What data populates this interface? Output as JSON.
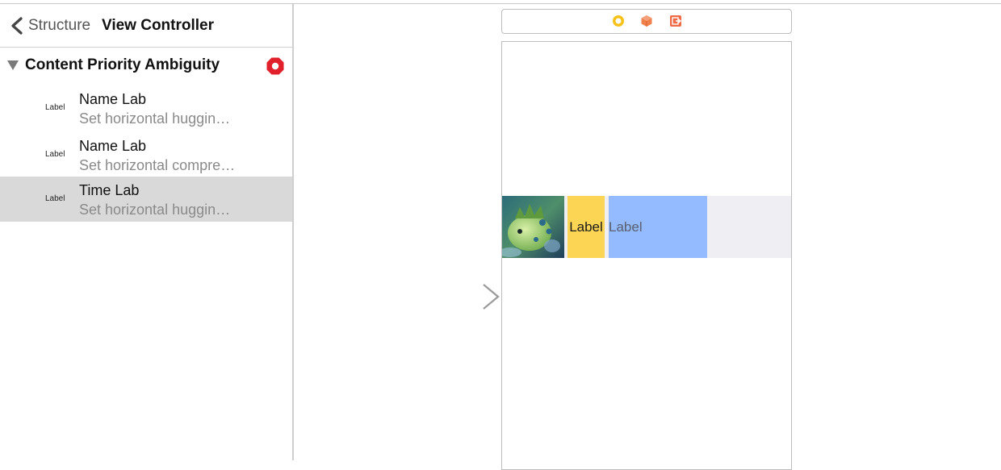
{
  "navigator": {
    "breadcrumb": {
      "parent": "Structure",
      "current": "View Controller"
    },
    "group": {
      "title": "Content Priority Ambiguity",
      "status_color": "#e0202a"
    },
    "issues": [
      {
        "tag": "Label",
        "title": "Name Lab",
        "subtitle": "Set horizontal huggin…",
        "selected": false
      },
      {
        "tag": "Label",
        "title": "Name Lab",
        "subtitle": "Set horizontal compre…",
        "selected": false
      },
      {
        "tag": "Label",
        "title": "Time Lab",
        "subtitle": "Set horizontal huggin…",
        "selected": true
      }
    ]
  },
  "canvas": {
    "dock_icons": [
      "view-controller-icon",
      "first-responder-icon",
      "exit-icon"
    ],
    "scene": {
      "name_label": "Label",
      "time_label": "Label",
      "colors": {
        "name_label_bg": "#fdd554",
        "time_label_bg": "#94bbff",
        "cell_bg": "#efeff3"
      }
    }
  }
}
